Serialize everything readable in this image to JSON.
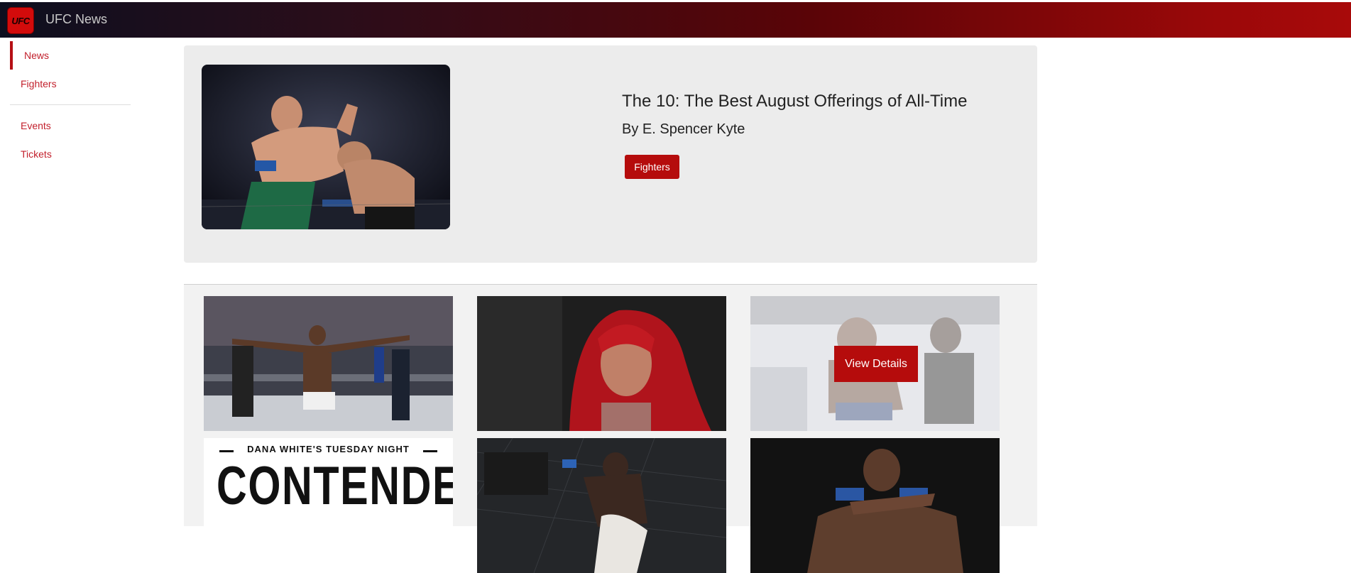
{
  "app": {
    "title": "UFC News",
    "logo_text": "UFC"
  },
  "sidebar": {
    "items": [
      {
        "label": "News",
        "active": true
      },
      {
        "label": "Fighters"
      },
      {
        "label": "Events"
      },
      {
        "label": "Tickets"
      }
    ]
  },
  "featured": {
    "title": "The 10: The Best August Offerings of All-Time",
    "author": "By E. Spencer Kyte",
    "tag_label": "Fighters"
  },
  "grid": {
    "view_details_label": "View Details",
    "poster_header": "DANA WHITE'S TUESDAY NIGHT",
    "poster_title": "CONTENDER"
  },
  "colors": {
    "accent": "#b50c0c",
    "nav_text": "#c21f2b",
    "panel_bg": "#ececec"
  }
}
